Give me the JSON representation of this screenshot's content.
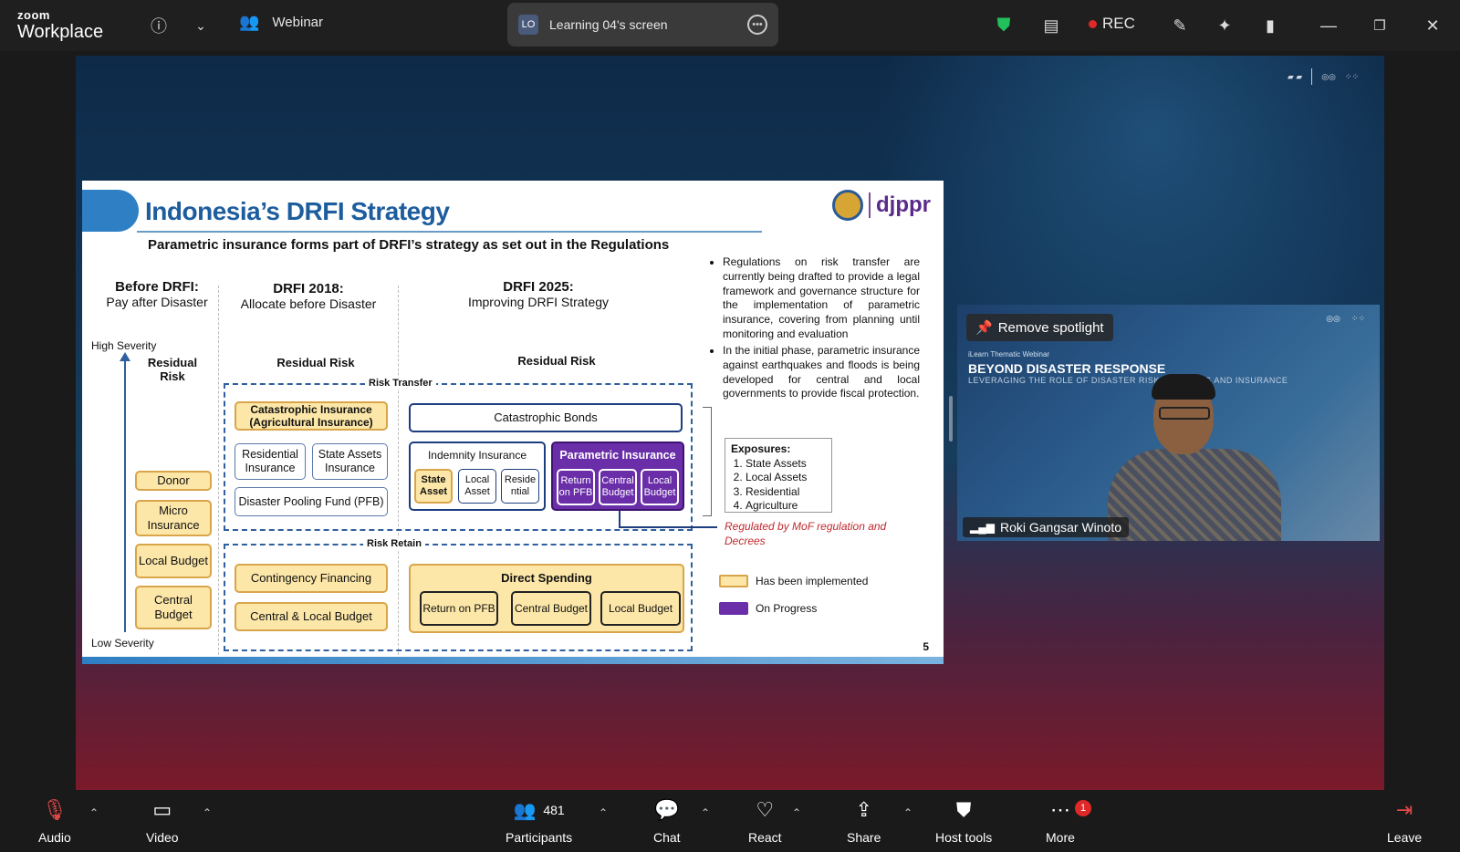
{
  "app": {
    "brand_small": "zoom",
    "brand_big": "Workplace",
    "mode": "Webinar"
  },
  "share_pill": {
    "avatar": "LO",
    "text": "Learning 04's screen"
  },
  "rec_label": "REC",
  "slide": {
    "title": "Indonesia’s DRFI Strategy",
    "logo_text": "djppr",
    "subtitle": "Parametric insurance forms part of DRFI’s strategy as set out in the Regulations",
    "col1_head": "Before DRFI:",
    "col1_sub": "Pay after Disaster",
    "col2_head": "DRFI 2018:",
    "col2_sub": "Allocate before Disaster",
    "col3_head": "DRFI 2025:",
    "col3_sub": "Improving DRFI Strategy",
    "high_severity": "High Severity",
    "low_severity": "Low Severity",
    "residual_risk": "Residual Risk",
    "risk_transfer": "Risk Transfer",
    "risk_retain": "Risk Retain",
    "col1_boxes": [
      "Donor",
      "Micro Insurance",
      "Local Budget",
      "Central Budget"
    ],
    "cat_ins": "Catastrophic Insurance (Agricultural Insurance)",
    "res_ins": "Residential Insurance",
    "state_ins": "State Assets Insurance",
    "pooling": "Disaster Pooling Fund (PFB)",
    "contingency": "Contingency Financing",
    "central_local": "Central & Local Budget",
    "cat_bonds": "Catastrophic Bonds",
    "indemnity": "Indemnity Insurance",
    "indemnity_items": [
      "State Asset",
      "Local Asset",
      "Reside ntial"
    ],
    "parametric": "Parametric Insurance",
    "parametric_items": [
      "Return on PFB",
      "Central Budget",
      "Local Budget"
    ],
    "direct_spending": "Direct Spending",
    "direct_items": [
      "Return on PFB",
      "Central Budget",
      "Local Budget"
    ],
    "bullet1": "Regulations on risk transfer are currently being drafted to provide a legal framework and governance structure for the implementation of parametric insurance, covering from planning until monitoring and evaluation",
    "bullet2": "In the initial phase, parametric insurance against earthquakes and floods is being developed for central and local governments to provide fiscal protection.",
    "exposures_title": "Exposures:",
    "exposures": [
      "State Assets",
      "Local Assets",
      "Residential",
      "Agriculture"
    ],
    "regulated": "Regulated by MoF regulation and Decrees",
    "legend_impl": "Has been implemented",
    "legend_prog": "On Progress",
    "page_number": "5"
  },
  "speaker": {
    "spotlight": "Remove spotlight",
    "small_text": "iLearn Thematic Webinar",
    "title": "BEYOND DISASTER RESPONSE",
    "sub": "LEVERAGING THE ROLE OF DISASTER RISK FINANCING AND INSURANCE",
    "name": "Roki Gangsar Winoto"
  },
  "toolbar": {
    "audio": "Audio",
    "video": "Video",
    "participants": "Participants",
    "participants_count": "481",
    "chat": "Chat",
    "react": "React",
    "share": "Share",
    "host_tools": "Host tools",
    "more": "More",
    "more_badge": "1",
    "leave": "Leave"
  },
  "colors": {
    "implemented": "#fce7a8",
    "progress": "#6a2ea8",
    "accent_blue": "#1d5d9e",
    "rec": "#e02828"
  }
}
